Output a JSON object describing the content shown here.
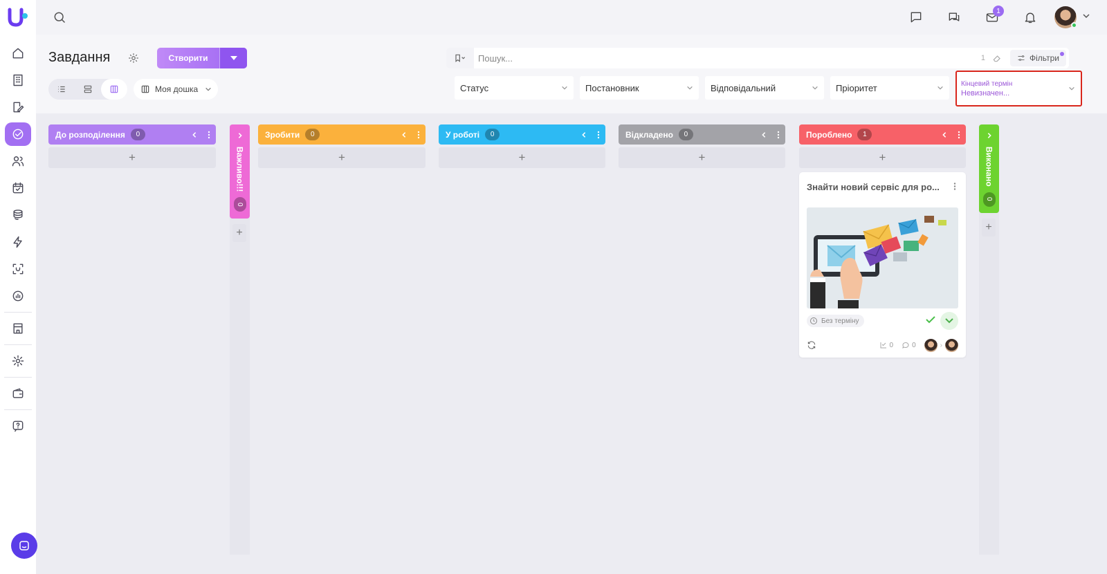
{
  "topbar": {
    "mail_badge": "1"
  },
  "header": {
    "title": "Завдання",
    "create_label": "Створити",
    "board_select": "Моя дошка",
    "search_placeholder": "Пошук...",
    "search_count": "1",
    "filters_label": "Фільтри"
  },
  "filters": {
    "status": "Статус",
    "author": "Постановник",
    "responsible": "Відповідальний",
    "priority": "Пріоритет",
    "deadline_label": "Кінцевий термін",
    "deadline_value": "Невизначен..."
  },
  "columns": [
    {
      "name": "До розподілення",
      "count": "0",
      "color": "#b07ff2"
    },
    {
      "name": "Важливо!!!",
      "count": "0",
      "color": "#ee6ad6"
    },
    {
      "name": "Зробити",
      "count": "0",
      "color": "#fbb13c"
    },
    {
      "name": "У роботі",
      "count": "0",
      "color": "#2dbaf3"
    },
    {
      "name": "Відкладено",
      "count": "0",
      "color": "#a3a3a8"
    },
    {
      "name": "Пороблено",
      "count": "1",
      "color": "#f76168"
    },
    {
      "name": "Виконано",
      "count": "0",
      "color": "#6dd330"
    }
  ],
  "card": {
    "title": "Знайти новий сервіс для ро...",
    "deadline": "Без терміну",
    "subtasks": "0",
    "comments": "0"
  }
}
